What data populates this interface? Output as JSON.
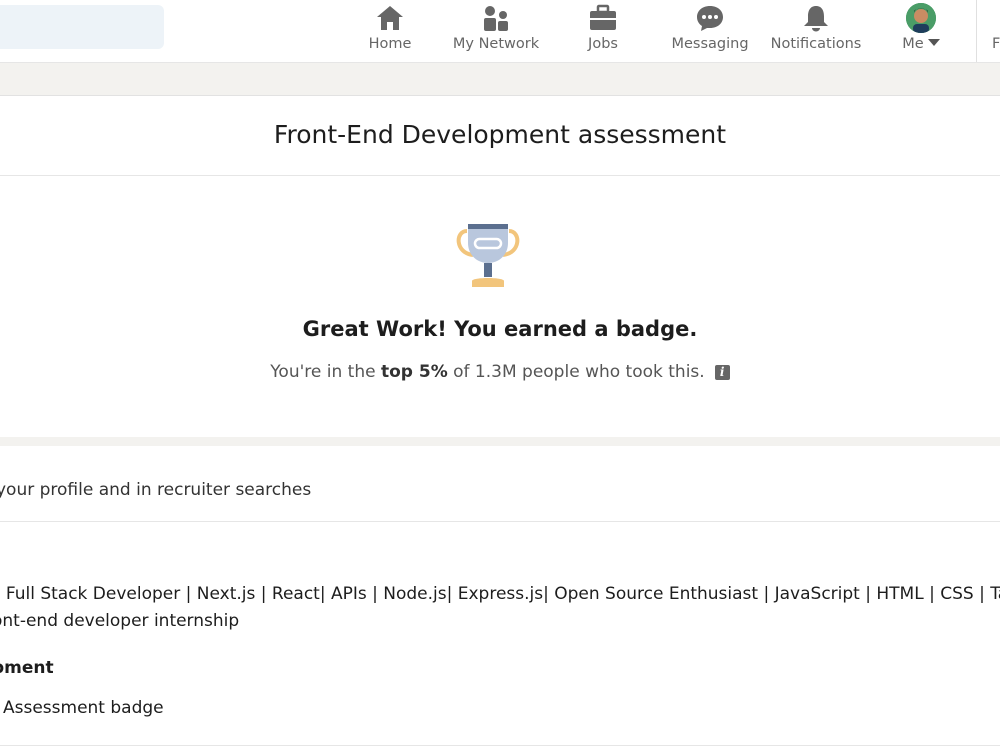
{
  "nav": {
    "items": [
      {
        "label": "Home",
        "icon": "home-icon"
      },
      {
        "label": "My Network",
        "icon": "network-icon"
      },
      {
        "label": "Jobs",
        "icon": "briefcase-icon"
      },
      {
        "label": "Messaging",
        "icon": "message-icon"
      },
      {
        "label": "Notifications",
        "icon": "bell-icon"
      },
      {
        "label": "Me",
        "icon": "avatar"
      }
    ],
    "cut_label": "F"
  },
  "assessment": {
    "title": "Front-End Development assessment",
    "badge_heading": "Great Work! You earned a badge.",
    "percentile_prefix": "You're in the ",
    "percentile_bold": "top 5%",
    "percentile_suffix": " of 1.3M people who took this.",
    "info_icon_text": "i"
  },
  "profile": {
    "visibility_text": "your profile and in recruiter searches",
    "headline": "e Full Stack Developer | Next.js | React| APIs | Node.js| Express.js| Open Source Enthusiast | JavaScript | HTML | CSS | Tailwi",
    "goal": "ont-end developer internship",
    "skill": "pment",
    "badge_name": "Assessment badge"
  },
  "colors": {
    "accent_gray": "#666666",
    "page_bg": "#f3f2ef",
    "trophy_silver": "#b9c7dd",
    "trophy_gold": "#f2c57c"
  }
}
